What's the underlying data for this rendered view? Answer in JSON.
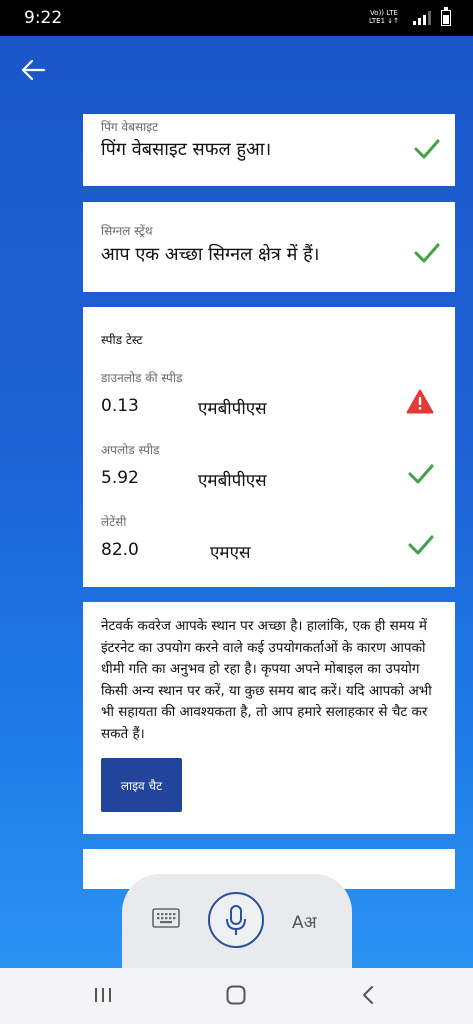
{
  "status_bar": {
    "time": "9:22",
    "network_line1": "Vo)) LTE",
    "network_line2": "LTE1 ↓↑"
  },
  "ping_card": {
    "caption": "पिंग वेबसाइट",
    "message": "पिंग वेबसाइट सफल हुआ।",
    "status_icon": "check-icon"
  },
  "signal_card": {
    "caption": "सिग्नल स्ट्रेंथ",
    "message": "आप एक अच्छा सिग्नल क्षेत्र में हैं।",
    "status_icon": "check-icon"
  },
  "speed_card": {
    "title": "स्पीड टेस्ट",
    "metrics": [
      {
        "label": "डाउनलोड की स्पीड",
        "value": "0.13",
        "unit": "एमबीपीएस",
        "status_icon": "warning-icon"
      },
      {
        "label": "अपलोड स्पीड",
        "value": "5.92",
        "unit": "एमबीपीएस",
        "status_icon": "check-icon"
      },
      {
        "label": "लेटेंसी",
        "value": "82.0",
        "unit": "एमएस",
        "status_icon": "check-icon"
      }
    ]
  },
  "message_card": {
    "text": "नेटवर्क कवरेज आपके स्थान पर अच्छा है। हालांकि, एक ही समय में इंटरनेट का उपयोग करने वाले कई उपयोगकर्ताओं के कारण आपको धीमी गति का अनुभव हो रहा है। कृपया अपने मोबाइल का उपयोग किसी अन्य स्थान पर करें, या कुछ समय बाद करें। यदि आपको अभी भी सहायता की आवश्यकता है, तो आप हमारे सलाहकार से चैट कर सकते हैं।",
    "button_label": "लाइव चैट"
  },
  "input_panel": {
    "translate_label": "Aअ"
  },
  "colors": {
    "check": "#43a047",
    "warning": "#e53935",
    "button": "#21459a",
    "background": "#1d63d6"
  }
}
